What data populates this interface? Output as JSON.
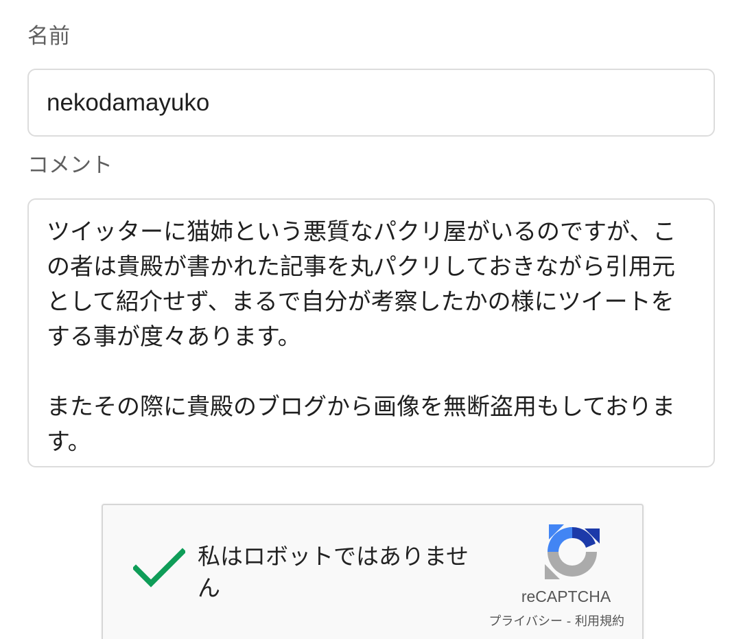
{
  "form": {
    "name_label": "名前",
    "name_value": "nekodamayuko",
    "comment_label": "コメント",
    "comment_paragraphs": [
      "ツイッターに猫姉という悪質なパクリ屋がいるのですが、この者は貴殿が書かれた記事を丸パクリしておきながら引用元として紹介せず、まるで自分が考察したかの様にツイートをする事が度々あります。",
      "またその際に貴殿のブログから画像を無断盗用もしております。"
    ]
  },
  "recaptcha": {
    "checkbox_label": "私はロボットではありません",
    "checked": true,
    "brand": "reCAPTCHA",
    "privacy_link": "プライバシー",
    "separator": " - ",
    "terms_link": "利用規約",
    "check_color": "#0f9d58",
    "icons": [
      "checkmark-icon",
      "recaptcha-logo-icon"
    ]
  }
}
